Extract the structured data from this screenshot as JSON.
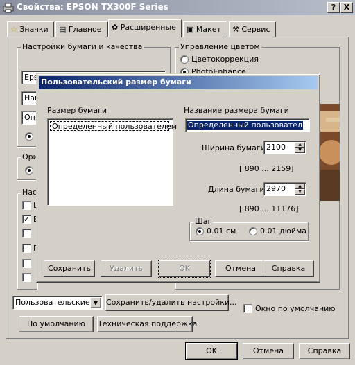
{
  "window": {
    "title": "Свойства: EPSON TX300F Series",
    "help_btn": "?",
    "close_btn": "X"
  },
  "tabs": [
    {
      "label": "Значки",
      "icon": "star-icon"
    },
    {
      "label": "Главное",
      "icon": "printer-icon"
    },
    {
      "label": "Расширенные",
      "icon": "advanced-icon"
    },
    {
      "label": "Макет",
      "icon": "layout-icon"
    },
    {
      "label": "Сервис",
      "icon": "wrench-icon"
    }
  ],
  "background": {
    "paper_group": "Настройки бумаги и качества",
    "paper_combo1": "Eps",
    "paper_combo2": "Наи",
    "paper_combo3": "Опр",
    "orient_group": "Ори",
    "extra_group": "Нас",
    "color_group": "Управление цветом",
    "color_opt1": "Цветокоррекция",
    "color_opt2": "PhotoEnhance",
    "extra_checks": [
      "Ш",
      "В",
      "",
      "П",
      "",
      ""
    ]
  },
  "bottom": {
    "preset_select": "Пользовательские",
    "save_delete_btn": "Сохранить/удалить настройки...",
    "default_window_check": "Окно по умолчанию",
    "defaults_btn": "По умолчанию",
    "support_btn": "Техническая поддержка",
    "ok": "OK",
    "cancel": "Отмена",
    "help": "Справка"
  },
  "dialog": {
    "title": "Пользовательский размер бумаги",
    "size_label": "Размер бумаги",
    "size_list": [
      "Определенный пользователем"
    ],
    "name_label": "Название размера бумаги",
    "name_value": "Определенный пользовател",
    "width_label": "Ширина бумаги",
    "width_value": "2100",
    "width_range": "[ 890 ... 2159]",
    "length_label": "Длина бумаги",
    "length_value": "2970",
    "length_range": "[ 890 ... 11176]",
    "step_group": "Шаг",
    "step_cm": "0.01 см",
    "step_inch": "0.01 дюйма",
    "save": "Сохранить",
    "delete": "Удалить",
    "ok": "OK",
    "cancel": "Отмена",
    "help": "Справка"
  }
}
